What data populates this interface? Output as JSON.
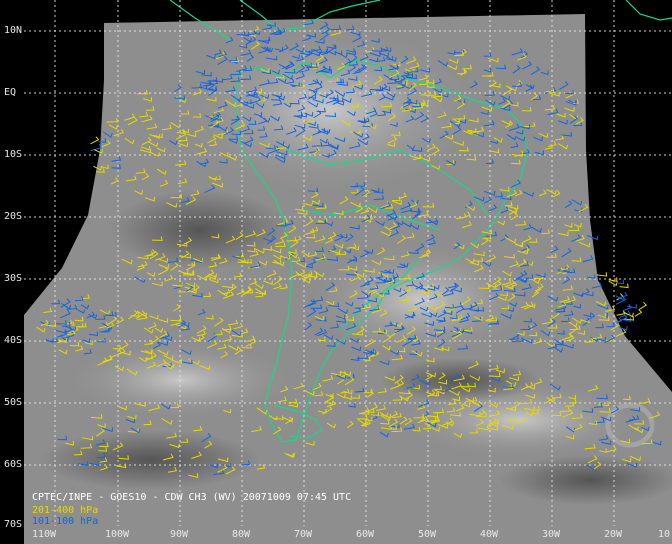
{
  "caption": "CPTEC/INPE - GOES10 - CDW CH3 (WV) 20071009 07:45 UTC",
  "legend": [
    {
      "label": "201-400 hPa",
      "color": "#e6d800"
    },
    {
      "label": "101-100 hPa",
      "color": "#1565e0"
    }
  ],
  "lat_labels": [
    "10N",
    "EQ",
    "10S",
    "20S",
    "30S",
    "40S",
    "50S",
    "60S",
    "70S"
  ],
  "lon_labels": [
    "110W",
    "100W",
    "90W",
    "80W",
    "70W",
    "60W",
    "50W",
    "40W",
    "30W",
    "20W",
    "10"
  ],
  "colors": {
    "coastline": "#19d68c",
    "graticule": "#e0e0e0",
    "background": "#000000",
    "wv_image": "#8a8a8a"
  }
}
